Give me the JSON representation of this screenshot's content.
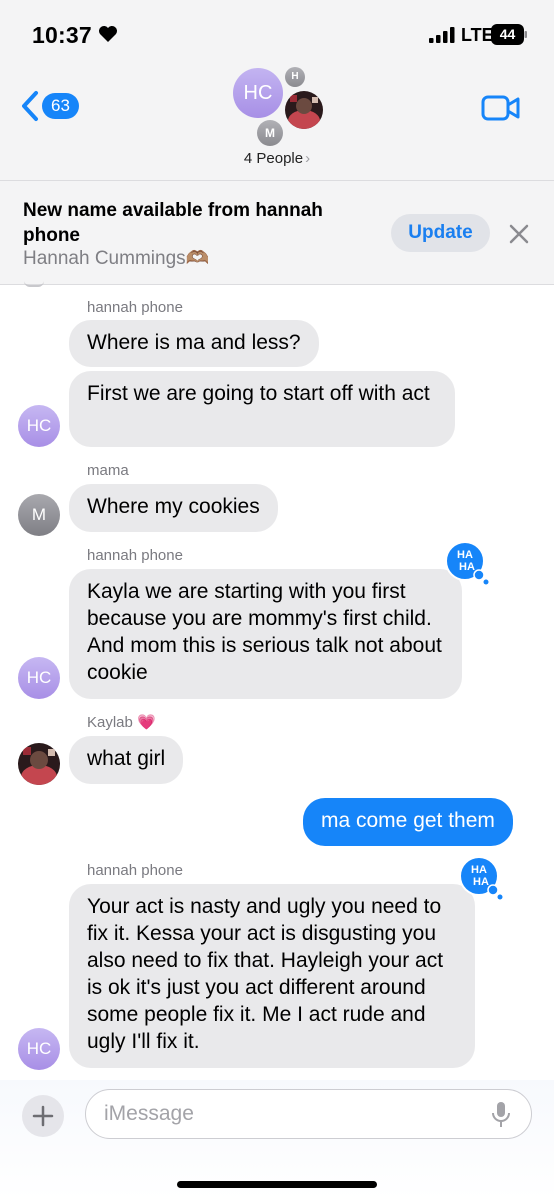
{
  "status_bar": {
    "time": "10:37",
    "network": "LTE",
    "battery": "44"
  },
  "nav": {
    "unread_count": "63",
    "group_initials": "HC",
    "small_avatar_1": "H",
    "small_avatar_2": "M",
    "people_label": "4 People",
    "people_chevron": "›"
  },
  "banner": {
    "title": "New name available from hannah phone",
    "subtitle": "Hannah Cummings🫶🏽",
    "update_label": "Update"
  },
  "messages": [
    {
      "sender": "hannah phone",
      "text": "Where is ma and less?"
    },
    {
      "text": "First we are going to start off with act",
      "avatar": "HC"
    },
    {
      "sender": "mama",
      "text": "Where my cookies",
      "avatar": "M"
    },
    {
      "sender": "hannah phone",
      "text": "Kayla we are starting with you first because you are mommy's first child. And mom this is serious talk not about cookie",
      "avatar": "HC",
      "tapback": "HA HA"
    },
    {
      "sender": "Kaylab 💗",
      "text": "what girl"
    },
    {
      "text": "ma come get them",
      "outgoing": true
    },
    {
      "sender": "hannah phone",
      "text": "Your act is nasty and ugly you need to fix it. Kessa your act is disgusting you also need to fix that. Hayleigh your act is ok it's just you act different around some people fix it. Me I act rude and ugly I'll fix it.",
      "avatar": "HC",
      "tapback": "HA HA"
    }
  ],
  "tapback": {
    "line1": "HA",
    "line2": "HA"
  },
  "compose": {
    "placeholder": "iMessage"
  },
  "colors": {
    "accent_blue": "#1685f9",
    "incoming_bubble": "#e9e9eb",
    "avatar_purple": "#a88fe6",
    "update_text": "#1a7ff0"
  },
  "icons": [
    "heart-icon",
    "signal-icon",
    "battery-icon",
    "chevron-back-icon",
    "video-camera-icon",
    "close-icon",
    "plus-icon",
    "microphone-icon",
    "haha-tapback-icon"
  ]
}
